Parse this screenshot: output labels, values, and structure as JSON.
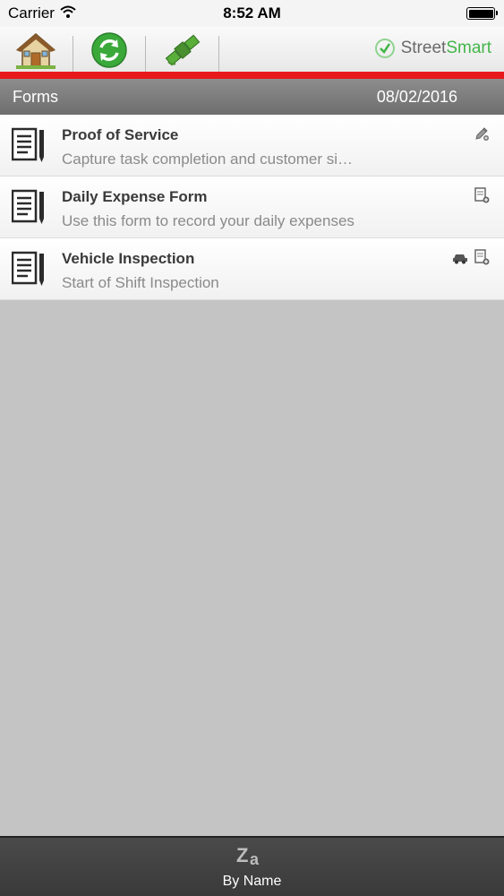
{
  "status_bar": {
    "carrier": "Carrier",
    "time": "8:52 AM"
  },
  "toolbar": {
    "buttons": [
      "home-icon",
      "sync-icon",
      "satellite-icon"
    ],
    "brand_part1": "Street",
    "brand_part2": "Smart"
  },
  "header": {
    "title": "Forms",
    "date": "08/02/2016"
  },
  "forms": [
    {
      "name": "Proof of Service",
      "description": "Capture task completion and customer si…",
      "actions": [
        "edit-pencil-icon"
      ]
    },
    {
      "name": "Daily Expense Form",
      "description": "Use this form to record your daily expenses",
      "actions": [
        "new-form-icon"
      ]
    },
    {
      "name": "Vehicle Inspection",
      "description": "Start of Shift Inspection",
      "actions": [
        "vehicle-icon",
        "new-form-icon"
      ]
    }
  ],
  "bottom_bar": {
    "sort_label": "By Name",
    "sort_icon": "sort-za-icon"
  },
  "colors": {
    "accent_red": "#e8191b",
    "brand_green": "#43b649",
    "background": "#c4c4c4"
  }
}
